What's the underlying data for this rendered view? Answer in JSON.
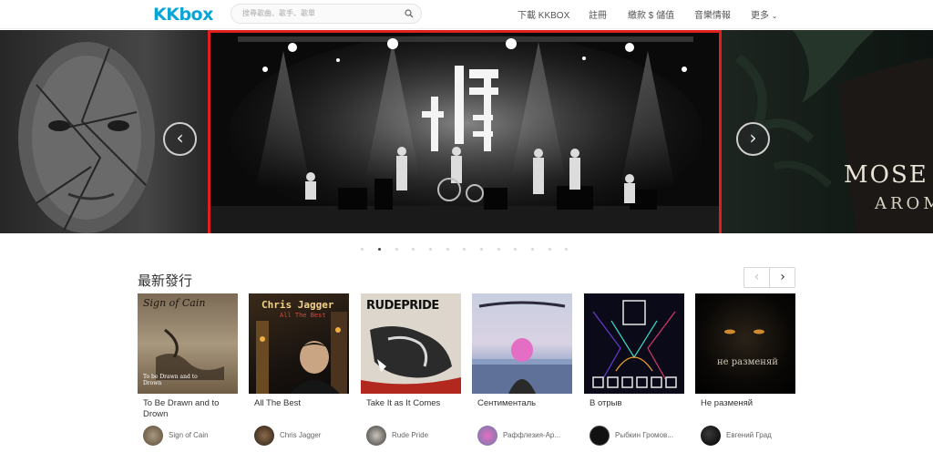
{
  "header": {
    "logo": "KKbox",
    "search_placeholder": "搜尋歌曲、歌手、歌單",
    "nav": [
      "下載 KKBOX",
      "註冊",
      "繳款 $ 儲值",
      "音樂情報",
      "更多"
    ]
  },
  "banner": {
    "right_title_line1": "MOSE",
    "right_title_line2": "AROM",
    "slide_count": 13,
    "active_slide": 2
  },
  "section": {
    "title": "最新發行"
  },
  "albums": [
    {
      "title": "To Be Drawn and to Drown",
      "artist": "Sign of Cain"
    },
    {
      "title": "All The Best",
      "artist": "Chris Jagger"
    },
    {
      "title": "Take It as It Comes",
      "artist": "Rude Pride"
    },
    {
      "title": "Сентименталь",
      "artist": "Раффлезия-Ар..."
    },
    {
      "title": "В отрыв",
      "artist": "Рыбкин Громов..."
    },
    {
      "title": "Не разменяй",
      "artist": "Евгений Град"
    }
  ],
  "cover_text": {
    "a1_top": "Sign of Cain",
    "a1_bottom": "To be Drawn and to Drown",
    "a2_line1": "Chris Jagger",
    "a2_line2": "All The Best",
    "a3_logo": "RUDEPRIDE",
    "a6_text": "не разменяй"
  },
  "colors": {
    "brand": "#09a5d6",
    "highlight_border": "#e01f1f"
  }
}
